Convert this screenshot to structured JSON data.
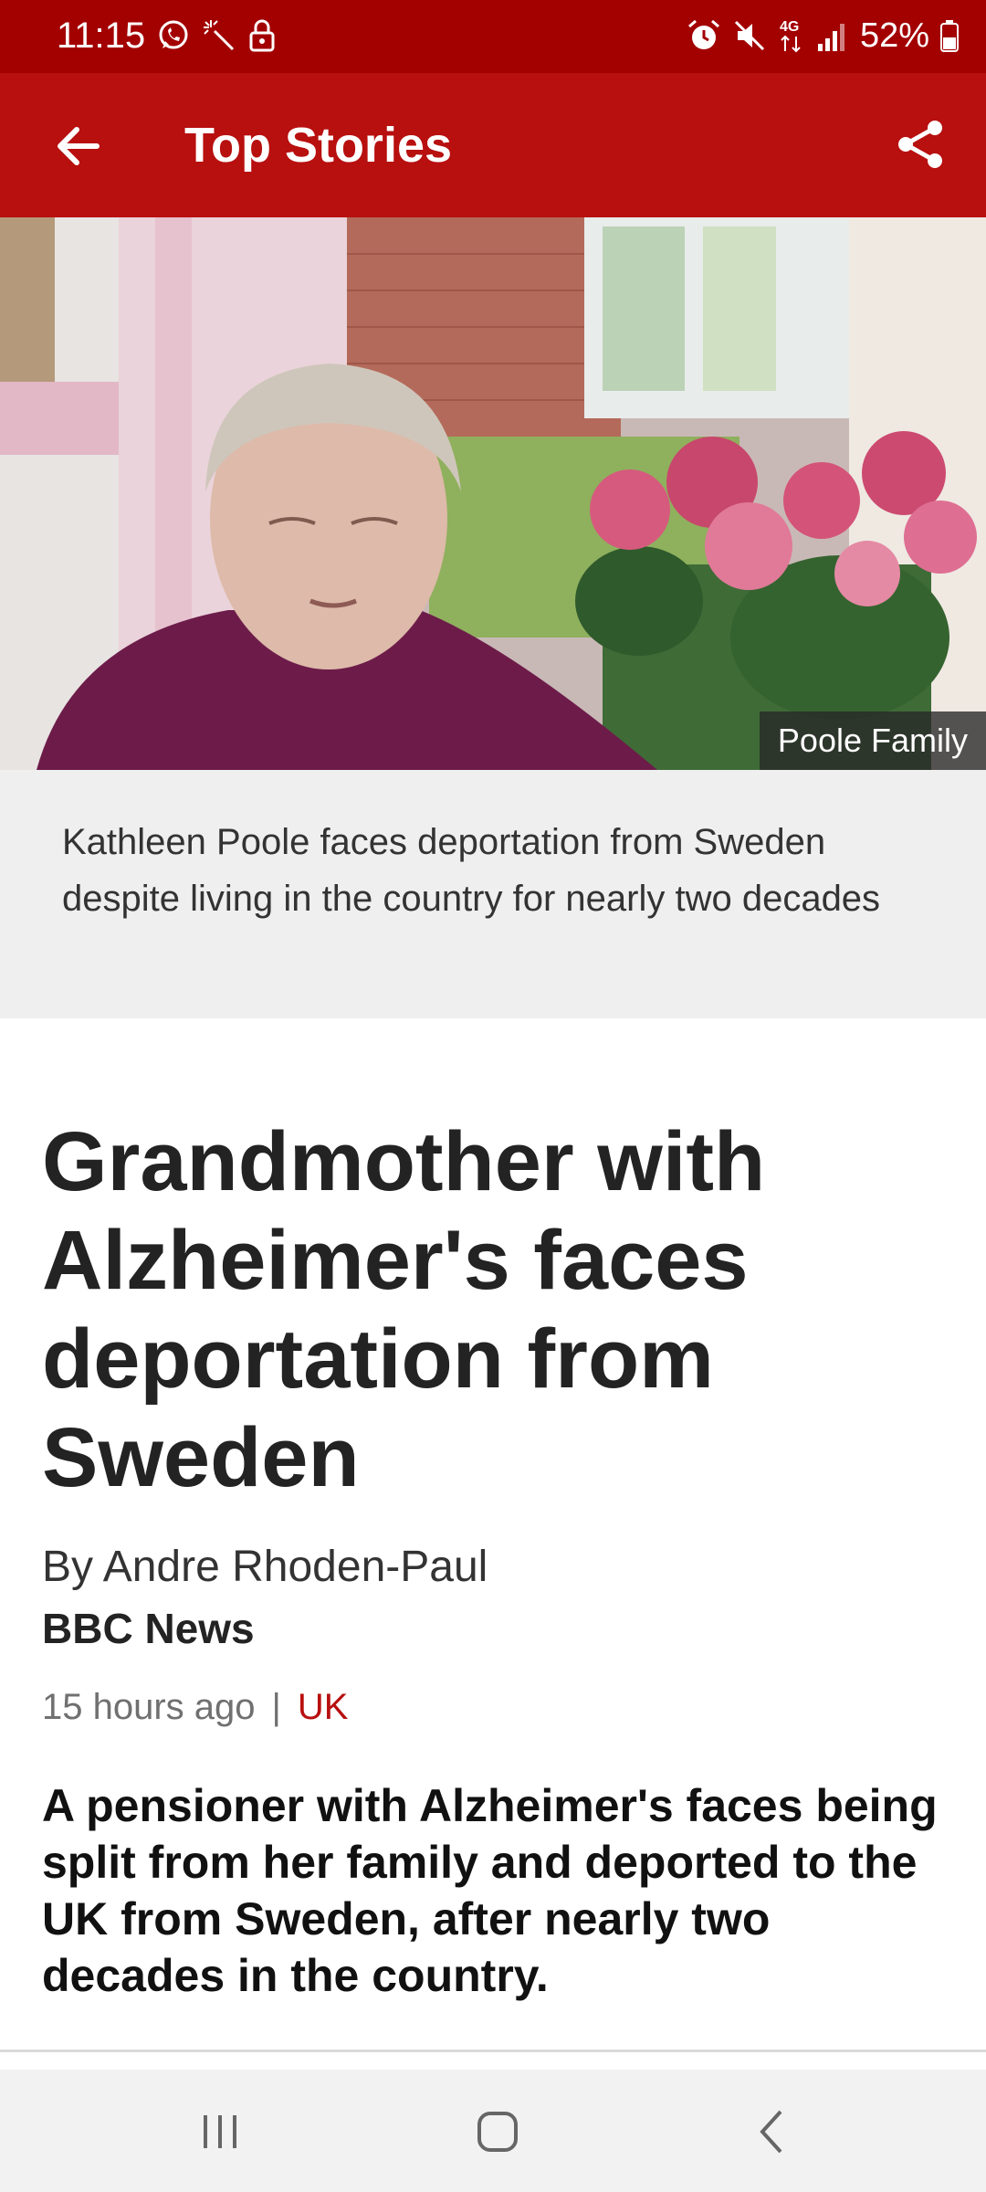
{
  "status_bar": {
    "time": "11:15",
    "battery": "52%",
    "left_icons": [
      "whatsapp-icon",
      "magic-wand-icon",
      "lock-icon"
    ],
    "right_icons": [
      "alarm-icon",
      "mute-icon",
      "4g-data-icon",
      "signal-icon",
      "battery-icon"
    ]
  },
  "app_bar": {
    "title": "Top Stories",
    "back_icon": "arrow-left-icon",
    "share_icon": "share-icon"
  },
  "hero": {
    "photo_credit": "Poole Family",
    "caption": "Kathleen Poole faces deportation from Sweden despite living in the country for nearly two decades"
  },
  "article": {
    "headline": "Grandmother with Alzheimer's faces deportation from Sweden",
    "byline": "By Andre Rhoden-Paul",
    "source": "BBC News",
    "timestamp": "15 hours ago",
    "separator": "|",
    "section": "UK",
    "summary": "A pensioner with Alzheimer's faces being split from her family and deported to the UK from Sweden, after nearly two decades in the country."
  },
  "nav_bar": {
    "icons": [
      "recent-apps-icon",
      "home-icon",
      "back-icon"
    ]
  },
  "colors": {
    "status_bar": "#a30000",
    "app_bar": "#b80f0f",
    "section_tag": "#b80f0f",
    "caption_background": "#efefef"
  }
}
